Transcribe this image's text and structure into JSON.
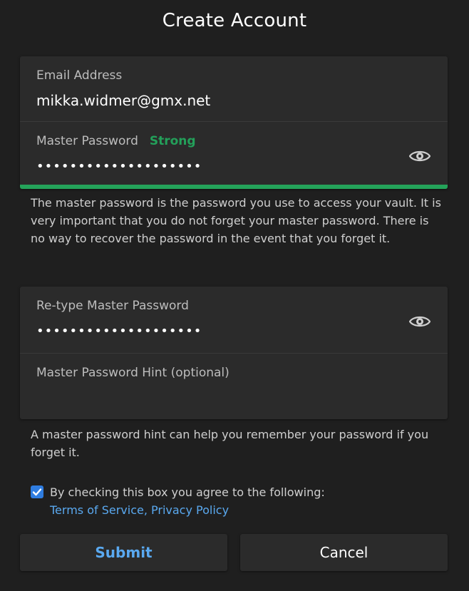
{
  "page_title": "Create Account",
  "email": {
    "label": "Email Address",
    "value": "mikka.widmer@gmx.net"
  },
  "master_password": {
    "label": "Master Password",
    "strength": "Strong",
    "value": "••••••••••••••••••••",
    "visibility_icon": "eye-icon"
  },
  "master_password_help": "The master password is the password you use to access your vault. It is very important that you do not forget your master password. There is no way to recover the password in the event that you forget it.",
  "retype_password": {
    "label": "Re-type Master Password",
    "value": "••••••••••••••••••••",
    "visibility_icon": "eye-icon"
  },
  "hint": {
    "label": "Master Password Hint (optional)",
    "value": ""
  },
  "hint_help": "A master password hint can help you remember your password if you forget it.",
  "agreement": {
    "checked": true,
    "text": "By checking this box you agree to the following:",
    "terms_link": "Terms of Service",
    "separator": ", ",
    "privacy_link": "Privacy Policy"
  },
  "buttons": {
    "submit": "Submit",
    "cancel": "Cancel"
  },
  "colors": {
    "background": "#1f1f1f",
    "card": "#2b2b2b",
    "strength_green": "#24a35a",
    "link_blue": "#5aa9f0",
    "checkbox_blue": "#2f7de1"
  }
}
